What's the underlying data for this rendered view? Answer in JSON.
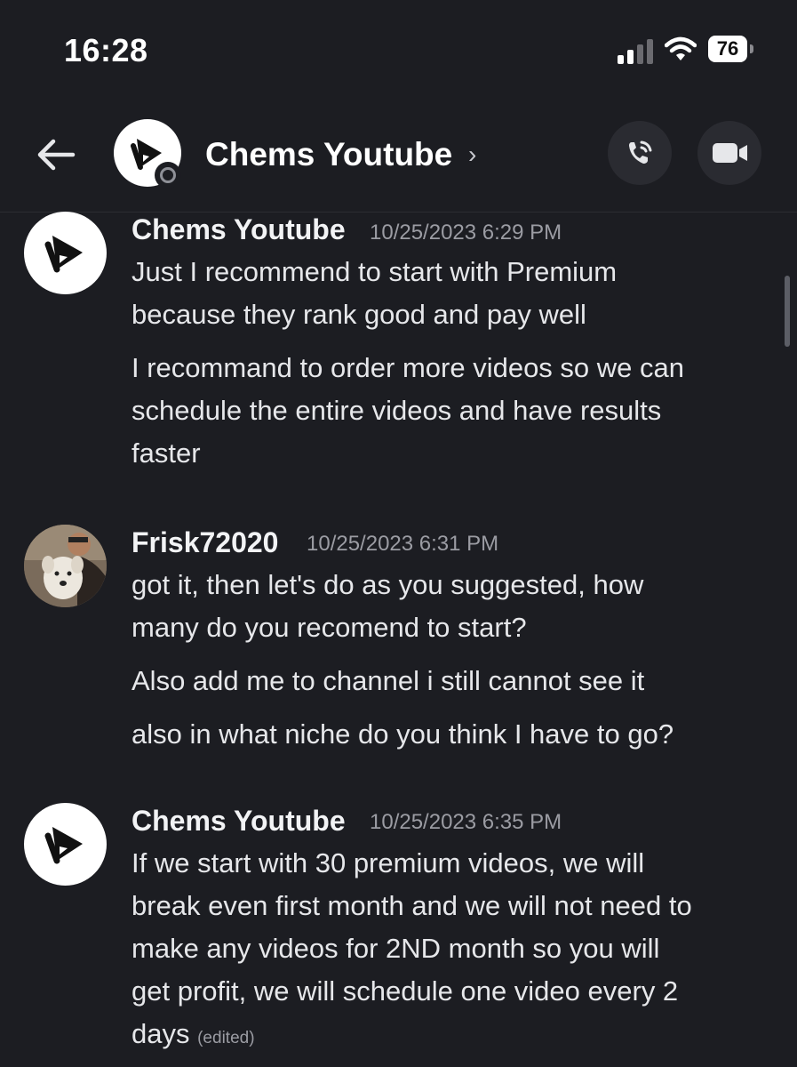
{
  "status_bar": {
    "time": "16:28",
    "battery_level": "76",
    "signal_bars_filled": 2,
    "signal_bars_total": 4
  },
  "header": {
    "back_icon": "arrow-left-icon",
    "channel_name": "Chems Youtube",
    "chevron": "›",
    "call_icon": "phone-icon",
    "video_icon": "video-camera-icon"
  },
  "messages": [
    {
      "author": "Chems Youtube",
      "timestamp": "10/25/2023 6:29 PM",
      "avatar": "play-logo-icon",
      "lines": [
        "Just I recommend to start with Premium",
        "because they rank good and pay well",
        "I recommand to order more videos so we can",
        "schedule the entire videos and have results",
        "faster"
      ]
    },
    {
      "author": "Frisk72020",
      "timestamp": "10/25/2023 6:31 PM",
      "avatar": "user-photo-avatar",
      "lines": [
        "got it, then let's do as you suggested, how",
        "many do you recomend to start?",
        "Also add me to channel i still cannot see it",
        "also in what niche do you think I have to go?"
      ]
    },
    {
      "author": "Chems Youtube",
      "timestamp": "10/25/2023 6:35 PM",
      "avatar": "play-logo-icon",
      "lines": [
        "If we start with 30 premium videos, we will",
        "break even first month and we will not need to",
        "make any videos for 2ND month so you will",
        "get profit, we will schedule one video every 2",
        "days"
      ],
      "edited_label": "(edited)"
    }
  ],
  "colors": {
    "background": "#1c1d22",
    "text": "#e6e7ea",
    "muted": "#9b9ca3",
    "button_bg": "#2a2b31"
  }
}
